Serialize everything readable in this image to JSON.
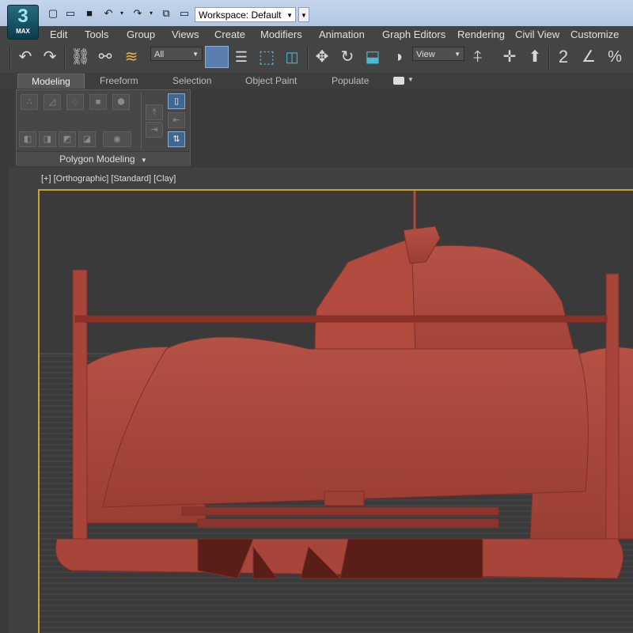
{
  "app": {
    "logo_number": "3",
    "logo_text": "MAX"
  },
  "quick_access": {
    "workspace_label": "Workspace: Default"
  },
  "menu": [
    "Edit",
    "Tools",
    "Group",
    "Views",
    "Create",
    "Modifiers",
    "Animation",
    "Graph Editors",
    "Rendering",
    "Civil View",
    "Customize"
  ],
  "toolbar": {
    "selection_filter": "All",
    "reference_coord": "View",
    "icons": [
      "undo-icon",
      "redo-icon",
      "link-icon",
      "unlink-icon",
      "bind-space-warp-icon",
      "select-object-icon",
      "select-by-name-icon",
      "rectangle-region-icon",
      "window-crossing-icon",
      "move-icon",
      "rotate-icon",
      "scale-icon",
      "placement-icon",
      "mirror-pivot-icon",
      "align-icon",
      "snap-icon",
      "angle-snap-icon",
      "percent-snap-icon"
    ]
  },
  "ribbon": {
    "tabs": [
      "Modeling",
      "Freeform",
      "Selection",
      "Object Paint",
      "Populate"
    ],
    "active_tab": "Modeling",
    "panel_label": "Polygon Modeling"
  },
  "viewport": {
    "label": "[+] [Orthographic] [Standard] [Clay]",
    "accent": "#c9a32a",
    "model_color": "#b04a3e"
  }
}
